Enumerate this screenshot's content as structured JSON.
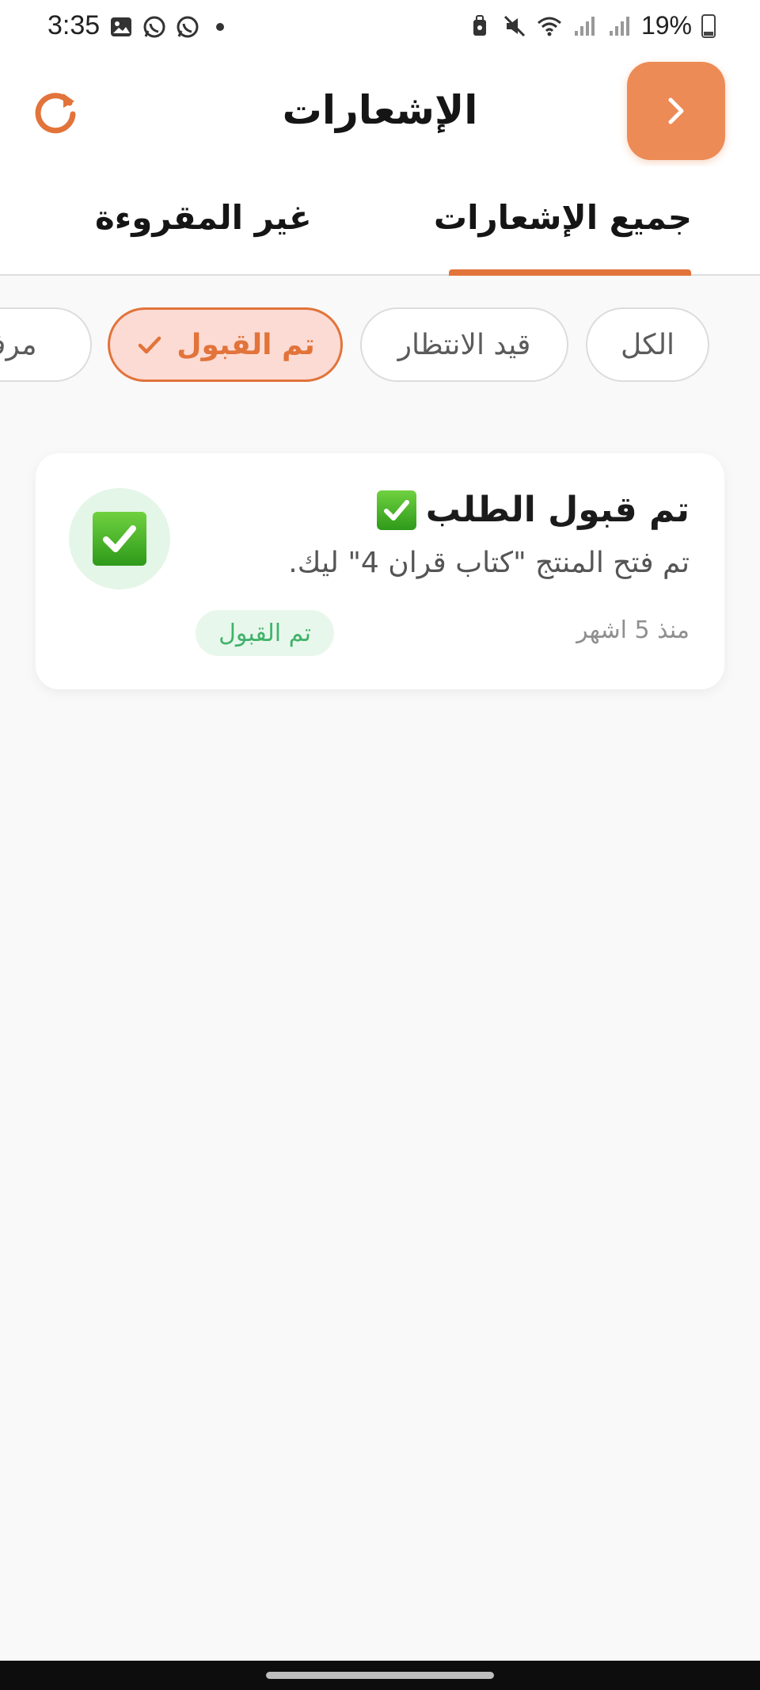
{
  "status_bar": {
    "time": "3:35",
    "battery": "19%",
    "icons": [
      "gallery-icon",
      "whatsapp-icon",
      "whatsapp-icon",
      "dot-icon",
      "vpn-lock-icon",
      "mute-icon",
      "wifi-icon",
      "signal-icon",
      "signal-icon",
      "battery-icon"
    ]
  },
  "header": {
    "title": "الإشعارات",
    "refresh_icon": "refresh-icon",
    "back_icon": "chevron-right-icon",
    "accent_color": "#e2733a",
    "back_button_color": "#ec8b56"
  },
  "tabs": [
    {
      "label": "جميع الإشعارات",
      "active": true
    },
    {
      "label": "غير المقروءة",
      "active": false
    }
  ],
  "filters": [
    {
      "label": "الكل",
      "selected": false
    },
    {
      "label": "قيد الانتظار",
      "selected": false
    },
    {
      "label": "تم القبول",
      "selected": true
    },
    {
      "label": "مرفوض",
      "selected": false
    }
  ],
  "notifications": [
    {
      "title": "تم قبول الطلب",
      "body": "تم فتح المنتج \"كتاب قران 4\" ليك.",
      "time": "منذ 5 اشهر",
      "status": "تم القبول",
      "icon": "check-mark-icon",
      "status_color": "#3fb36a"
    }
  ]
}
